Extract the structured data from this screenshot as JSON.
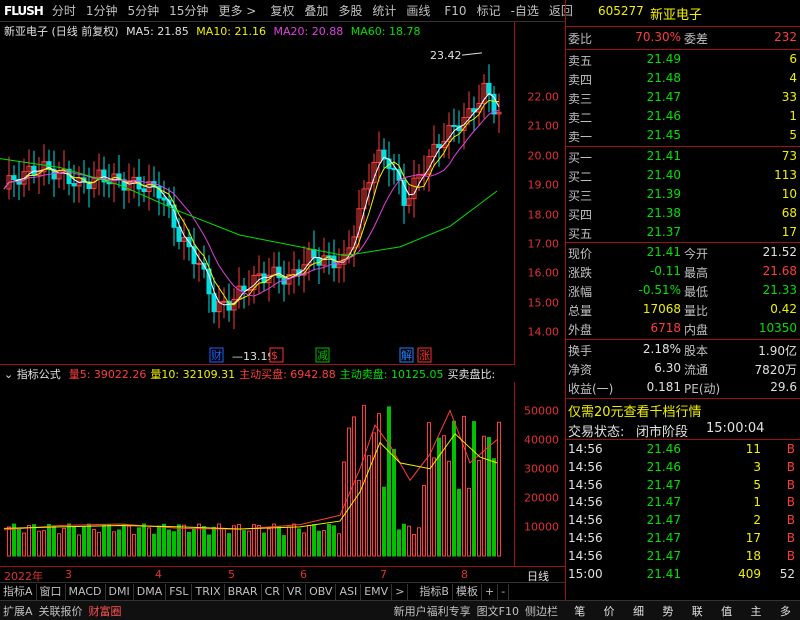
{
  "toolbar": {
    "logo": "FLUSH",
    "items": [
      "分时",
      "1分钟",
      "5分钟",
      "15分钟",
      "更多 >",
      "复权",
      "叠加",
      "多股",
      "统计",
      "画线",
      "F10",
      "标记",
      "-自选",
      "返回"
    ]
  },
  "chart_header": {
    "title": "新亚电子 (日线 前复权)",
    "ma5": "MA5: 21.85",
    "ma10": "MA10: 21.16",
    "ma20": "MA20: 20.88",
    "ma60": "MA60: 18.78"
  },
  "annotations": {
    "high": "23.42",
    "low": "13.19"
  },
  "event_tags": [
    "财",
    "$",
    "减",
    "解",
    "涨"
  ],
  "price_ticks": [
    "22.00",
    "21.00",
    "20.00",
    "19.00",
    "18.00",
    "17.00",
    "16.00",
    "15.00",
    "14.00"
  ],
  "vol_header": {
    "name": "指标公式",
    "v5": "量5: 39022.26",
    "v10": "量10: 32109.31",
    "buy": "主动买盘: 6942.88",
    "sell": "主动卖盘: 10125.05",
    "extra": "买卖盘比:"
  },
  "vol_ticks": [
    "50000",
    "40000",
    "30000",
    "20000",
    "10000"
  ],
  "date_axis": {
    "labels": [
      "2022年",
      "3",
      "4",
      "5",
      "6",
      "7",
      "8"
    ],
    "right": "日线"
  },
  "indicator_tabs": [
    "指标A",
    "窗口",
    "MACD",
    "DMI",
    "DMA",
    "FSL",
    "TRIX",
    "BRAR",
    "CR",
    "VR",
    "OBV",
    "ASI",
    "EMV",
    ">",
    "指标B",
    "模板",
    "+",
    "-"
  ],
  "statusbar": {
    "left": [
      "扩展A",
      "关联报价",
      "财富圈"
    ],
    "middle": [
      "新用户福利专享",
      "图文F10",
      "侧边栏"
    ],
    "right": [
      "笔",
      "价",
      "细",
      "势",
      "联",
      "值",
      "主",
      "多"
    ]
  },
  "quote": {
    "code": "605277",
    "name": "新亚电子",
    "webi_label": "委比",
    "webi": "70.30%",
    "weicha_label": "委差",
    "weicha": "232",
    "asks": [
      {
        "label": "卖五",
        "price": "21.49",
        "vol": "6"
      },
      {
        "label": "卖四",
        "price": "21.48",
        "vol": "4"
      },
      {
        "label": "卖三",
        "price": "21.47",
        "vol": "33"
      },
      {
        "label": "卖二",
        "price": "21.46",
        "vol": "1"
      },
      {
        "label": "卖一",
        "price": "21.45",
        "vol": "5"
      }
    ],
    "bids": [
      {
        "label": "买一",
        "price": "21.41",
        "vol": "73"
      },
      {
        "label": "买二",
        "price": "21.40",
        "vol": "113"
      },
      {
        "label": "买三",
        "price": "21.39",
        "vol": "10"
      },
      {
        "label": "买四",
        "price": "21.38",
        "vol": "68"
      },
      {
        "label": "买五",
        "price": "21.37",
        "vol": "17"
      }
    ],
    "stats": [
      {
        "l1": "现价",
        "v1": "21.41",
        "c1": "green",
        "l2": "今开",
        "v2": "21.52",
        "c2": "white"
      },
      {
        "l1": "涨跌",
        "v1": "-0.11",
        "c1": "green",
        "l2": "最高",
        "v2": "21.68",
        "c2": "red"
      },
      {
        "l1": "涨幅",
        "v1": "-0.51%",
        "c1": "green",
        "l2": "最低",
        "v2": "21.33",
        "c2": "green"
      },
      {
        "l1": "总量",
        "v1": "17068",
        "c1": "yellow",
        "l2": "量比",
        "v2": "0.42",
        "c2": "yellow"
      },
      {
        "l1": "外盘",
        "v1": "6718",
        "c1": "red",
        "l2": "内盘",
        "v2": "10350",
        "c2": "green"
      }
    ],
    "stats2": [
      {
        "l1": "换手",
        "v1": "2.18%",
        "l2": "股本",
        "v2": "1.90亿"
      },
      {
        "l1": "净资",
        "v1": "6.30",
        "l2": "流通",
        "v2": "7820万"
      },
      {
        "l1": "收益(一)",
        "v1": "0.181",
        "l2": "PE(动)",
        "v2": "29.6"
      }
    ],
    "promo": "仅需20元查看千档行情",
    "trade_state_label": "交易状态:",
    "trade_state": "闭市阶段",
    "trade_time": "15:00:04",
    "ticks": [
      {
        "t": "14:56",
        "p": "21.46",
        "v": "11",
        "s": "B"
      },
      {
        "t": "14:56",
        "p": "21.46",
        "v": "3",
        "s": "B"
      },
      {
        "t": "14:56",
        "p": "21.47",
        "v": "5",
        "s": "B"
      },
      {
        "t": "14:56",
        "p": "21.47",
        "v": "1",
        "s": "B"
      },
      {
        "t": "14:56",
        "p": "21.47",
        "v": "2",
        "s": "B"
      },
      {
        "t": "14:56",
        "p": "21.47",
        "v": "17",
        "s": "B"
      },
      {
        "t": "14:56",
        "p": "21.47",
        "v": "18",
        "s": "B"
      },
      {
        "t": "15:00",
        "p": "21.41",
        "v": "409",
        "s": "52"
      }
    ]
  },
  "colors": {
    "up": "#ff3c3c",
    "down": "#00e0e0",
    "ma5": "#ffffff",
    "ma10": "#f0f000",
    "ma20": "#e040e0",
    "ma60": "#00e000",
    "border": "#a01010"
  }
}
